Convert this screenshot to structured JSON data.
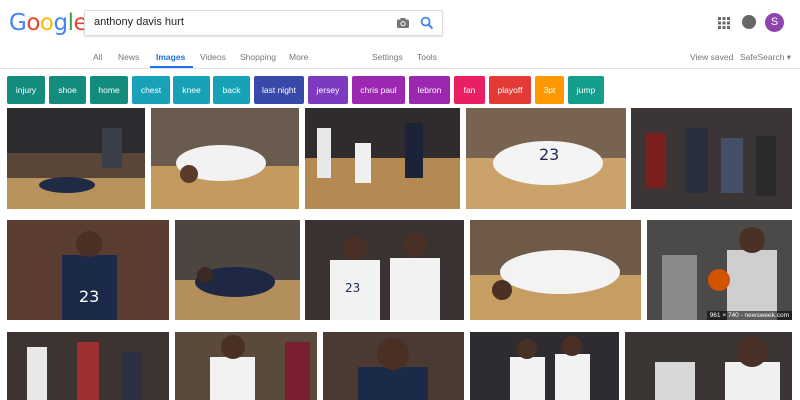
{
  "logo": {
    "letters": [
      "G",
      "o",
      "o",
      "g",
      "l",
      "e"
    ],
    "colors": [
      "#4285F4",
      "#EA4335",
      "#FBBC05",
      "#4285F4",
      "#34A853",
      "#EA4335"
    ]
  },
  "search": {
    "query": "anthony davis hurt"
  },
  "header": {
    "avatar_letter": "S",
    "icons": [
      "camera-icon",
      "search-icon",
      "apps-icon",
      "notifications-icon"
    ]
  },
  "nav": {
    "tabs": [
      "All",
      "News",
      "Images",
      "Videos",
      "Shopping",
      "More"
    ],
    "active": "Images",
    "settings": "Settings",
    "tools": "Tools",
    "view_saved": "View saved",
    "safesearch": "SafeSearch ▾"
  },
  "chips": [
    {
      "label": "injury",
      "color": "#138c7e"
    },
    {
      "label": "shoe",
      "color": "#138c7e"
    },
    {
      "label": "home",
      "color": "#138c7e"
    },
    {
      "label": "chest",
      "color": "#17a2b8"
    },
    {
      "label": "knee",
      "color": "#17a2b8"
    },
    {
      "label": "back",
      "color": "#17a2b8"
    },
    {
      "label": "last night",
      "color": "#3949ab"
    },
    {
      "label": "jersey",
      "color": "#7b3ac0"
    },
    {
      "label": "chris paul",
      "color": "#9c27b0"
    },
    {
      "label": "lebron",
      "color": "#9c27b0"
    },
    {
      "label": "fan",
      "color": "#e91e63"
    },
    {
      "label": "playoff",
      "color": "#e53935"
    },
    {
      "label": "3pt",
      "color": "#ff9800"
    },
    {
      "label": "jump",
      "color": "#159e8c"
    }
  ],
  "results": {
    "caption": "961 × 740 - newsweek.com"
  }
}
